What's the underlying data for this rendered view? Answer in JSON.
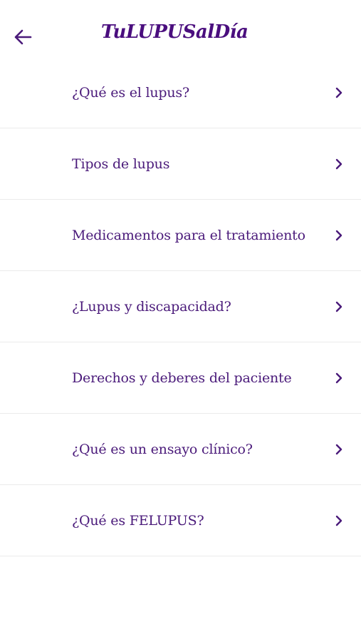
{
  "header": {
    "back_icon": "arrow-left-icon",
    "logo_text": "TuLUPUSalDía"
  },
  "colors": {
    "primary": "#4a1a7a",
    "divider": "#ebebeb",
    "background": "#ffffff"
  },
  "menu": {
    "chevron_icon": "chevron-right-icon",
    "items": [
      {
        "label": "¿Qué es el lupus?"
      },
      {
        "label": "Tipos de lupus"
      },
      {
        "label": "Medicamentos para el tratamiento"
      },
      {
        "label": "¿Lupus y discapacidad?"
      },
      {
        "label": "Derechos y deberes del paciente"
      },
      {
        "label": "¿Qué es un ensayo clínico?"
      },
      {
        "label": "¿Qué es FELUPUS?"
      }
    ]
  }
}
